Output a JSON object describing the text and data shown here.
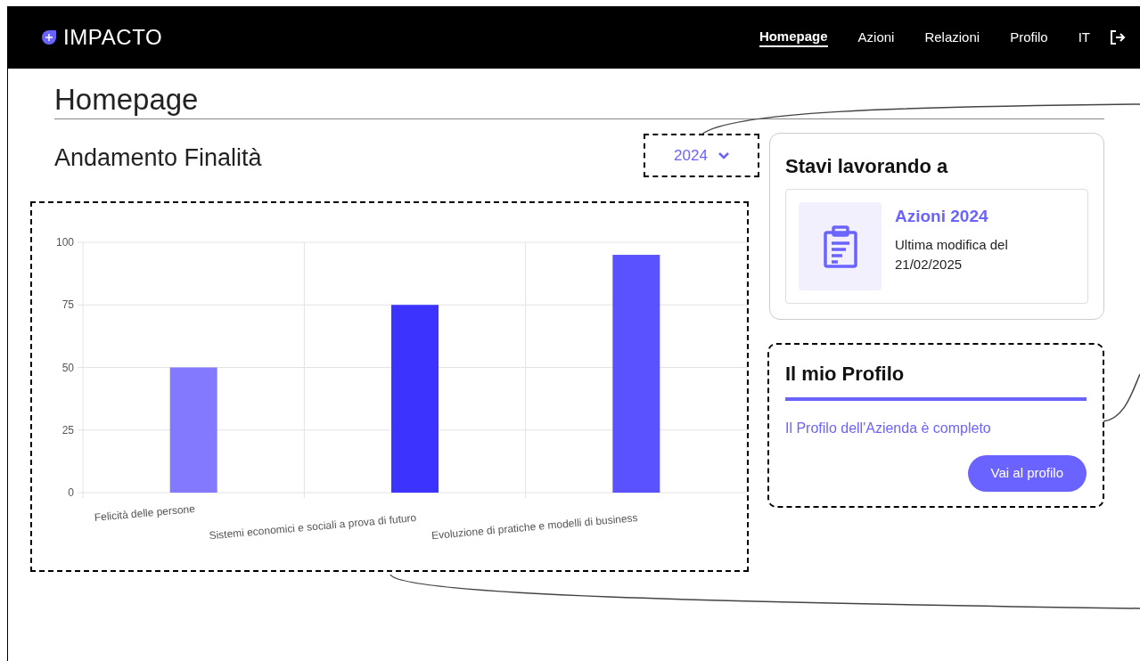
{
  "brand": {
    "name": "IMPACTO"
  },
  "nav": [
    {
      "label": "Homepage",
      "selected": true
    },
    {
      "label": "Azioni",
      "selected": false
    },
    {
      "label": "Relazioni",
      "selected": false
    },
    {
      "label": "Profilo",
      "selected": false
    },
    {
      "label": "IT",
      "selected": false
    }
  ],
  "page_title": "Homepage",
  "section_title": "Andamento Finalità",
  "year_select": {
    "value": "2024"
  },
  "chart_data": {
    "type": "bar",
    "categories": [
      "Felicità delle persone",
      "Sistemi economici e sociali a prova di futuro",
      "Evoluzione di pratiche e modelli di business"
    ],
    "series": [
      {
        "color": "#8279ff",
        "values": [
          50,
          null,
          null
        ]
      },
      {
        "color": "#3d33ff",
        "values": [
          null,
          75,
          null
        ]
      },
      {
        "color": "#5a52ff",
        "values": [
          null,
          null,
          95
        ]
      }
    ],
    "stacked": true,
    "grid": true,
    "ylim": [
      0,
      100
    ],
    "yticks": [
      0,
      25,
      50,
      75,
      100
    ]
  },
  "recent_card": {
    "title": "Stavi lavorando a",
    "item": {
      "title": "Azioni 2024",
      "subtitle": "Ultima modifica del 21/02/2025"
    }
  },
  "profile_card": {
    "title": "Il mio Profilo",
    "status": "Il Profilo dell'Azienda è completo",
    "button": "Vai al profilo"
  }
}
